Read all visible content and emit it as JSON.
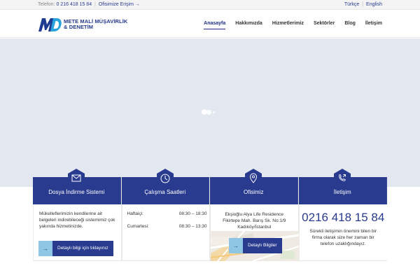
{
  "topbar": {
    "phone_label": "Telefon:",
    "phone": "0 216 418 15 84",
    "separator": "|",
    "access_link": "Ofisimize Erişim →",
    "lang_tr": "Türkçe",
    "lang_en": "English"
  },
  "brand": {
    "logo_text_line1": "METE MALİ MÜŞAVİRLİK",
    "logo_text_line2": "& DENETİM",
    "accent": "#293b8f"
  },
  "nav": {
    "items": [
      "Anasayfa",
      "Hakkımızda",
      "Hizmetlerimiz",
      "Sektörler",
      "Blog",
      "İletişim"
    ],
    "active_index": 0
  },
  "cards": [
    {
      "title": "Dosya İndirme Sistemi",
      "icon": "envelope-icon",
      "body": "Mükelleflerimizin kendilerine ait belgeleri indirebileceği sistemimiz çok yakında hizmetinizde.",
      "button": "Detaylı bilgi için tıklayınız"
    },
    {
      "title": "Çalışma Saatleri",
      "icon": "clock-icon",
      "hours": [
        {
          "day": "Haftaiçi:",
          "time": "08:30 – 18:30"
        },
        {
          "day": "Cumartesi:",
          "time": "08:30 – 13:30"
        }
      ]
    },
    {
      "title": "Ofisimiz",
      "icon": "map-pin-icon",
      "body": "Ekşioğlu Alya Life Residence Fikirtepe Mah. Barış Sk. No:1/9 Kadıköy/İstanbul",
      "button": "Detaylı Bilgiler"
    },
    {
      "title": "İletişim",
      "icon": "phone-icon",
      "phone": "0216 418 15 84",
      "body": "Sürekli iletişimin önemini bilen bir firma olarak size her zaman bir telefon uzaklığındayız."
    }
  ]
}
